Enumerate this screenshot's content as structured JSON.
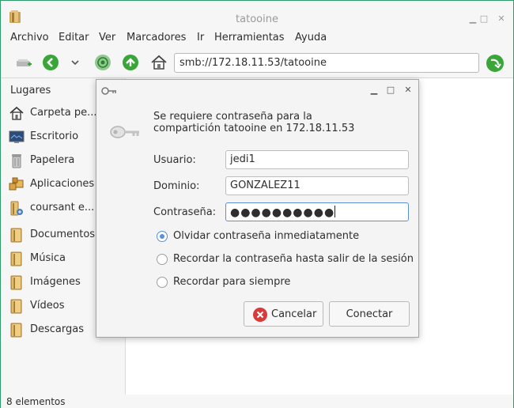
{
  "window": {
    "title": "tatooine"
  },
  "menu": [
    "Archivo",
    "Editar",
    "Ver",
    "Marcadores",
    "Ir",
    "Herramientas",
    "Ayuda"
  ],
  "toolbar": {
    "address": "smb://172.18.11.53/tatooine"
  },
  "sidebar": {
    "title": "Lugares",
    "items": [
      {
        "label": "Carpeta pe...",
        "icon": "home-icon"
      },
      {
        "label": "Escritorio",
        "icon": "desktop-icon"
      },
      {
        "label": "Papelera",
        "icon": "trash-icon"
      },
      {
        "label": "Aplicaciones",
        "icon": "applications-icon"
      },
      {
        "label": "coursant e...",
        "icon": "network-folder-icon"
      },
      {
        "label": "Documentos",
        "icon": "folder-icon"
      },
      {
        "label": "Música",
        "icon": "folder-icon"
      },
      {
        "label": "Imágenes",
        "icon": "folder-icon"
      },
      {
        "label": "Vídeos",
        "icon": "folder-icon"
      },
      {
        "label": "Descargas",
        "icon": "folder-icon"
      }
    ]
  },
  "status": {
    "text": "8 elementos"
  },
  "dialog": {
    "message_line1": "Se requiere contraseña para la",
    "message_line2": "compartición tatooine en 172.18.11.53",
    "user_label": "Usuario:",
    "user_value": "jedi1",
    "domain_label": "Dominio:",
    "domain_value": "GONZALEZ11",
    "password_label": "Contraseña:",
    "password_dots": "●●●●●●●●●●",
    "options": [
      {
        "label": "Olvidar contraseña inmediatamente",
        "checked": true
      },
      {
        "label": "Recordar la contraseña hasta salir de la sesión",
        "checked": false
      },
      {
        "label": "Recordar para siempre",
        "checked": false
      }
    ],
    "cancel_label": "Cancelar",
    "connect_label": "Conectar"
  },
  "colors": {
    "accent": "#2e9b6a",
    "focus": "#5a90d6",
    "nav_green": "#3aa63a"
  }
}
